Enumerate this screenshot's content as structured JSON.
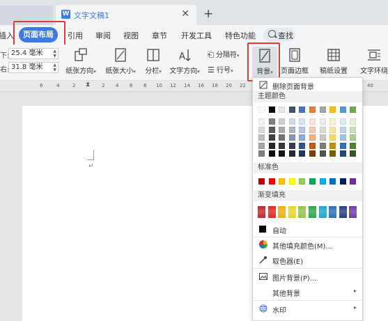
{
  "titlebar": {
    "doc_icon": "W",
    "doc_title": "文字文稿1",
    "close_symbol": "✕",
    "new_tab_symbol": "+"
  },
  "menu": {
    "items_left": "插入",
    "active": "页面布局",
    "items": [
      "引用",
      "审阅",
      "视图",
      "章节",
      "开发工具",
      "特色功能"
    ],
    "search": "查找"
  },
  "ribbon": {
    "margin_top_label": "下:",
    "margin_top_value": "25.4 毫米",
    "margin_right_label": "右:",
    "margin_right_value": "31.8 毫米",
    "buttons": [
      "纸张方向",
      "纸张大小",
      "分栏",
      "文字方向",
      "背景",
      "页面边框",
      "稿纸设置",
      "文字环绕"
    ],
    "small_buttons": [
      "分隔符",
      "行号"
    ]
  },
  "ruler": {
    "numbers": [
      "6",
      "4",
      "2",
      "2",
      "4",
      "6",
      "8",
      "10",
      "12",
      "14",
      "16",
      "18",
      "20",
      "22",
      "24",
      "26",
      "28",
      "30",
      "32",
      "34",
      "36",
      "38",
      "40"
    ]
  },
  "dropdown": {
    "remove_bg": "删除页面背景",
    "theme_colors_title": "主题颜色",
    "standard_colors_title": "标准色",
    "gradient_title": "渐变填充",
    "auto": "自动",
    "more_fill": "其他填充颜色(M)...",
    "eyedropper": "取色器(E)",
    "picture_bg": "图片背景(P)...",
    "other_bg": "其他背景",
    "watermark": "水印",
    "theme_top_row": [
      "#ffffff",
      "#000000",
      "#e7e6e6",
      "#44546a",
      "#4472c4",
      "#ed7d31",
      "#a5a5a5",
      "#ffc000",
      "#5b9bd5",
      "#70ad47"
    ],
    "theme_shades": [
      [
        "#f2f2f2",
        "#7f7f7f",
        "#d0cece",
        "#d6dce4",
        "#d9e2f3",
        "#fbe5d6",
        "#ededed",
        "#fff2cc",
        "#deebf7",
        "#e2f0d9"
      ],
      [
        "#d9d9d9",
        "#595959",
        "#aeabab",
        "#adb9ca",
        "#b4c7e7",
        "#f8cbad",
        "#dbdbdb",
        "#ffe699",
        "#bdd7ee",
        "#c5e0b4"
      ],
      [
        "#bfbfbf",
        "#404040",
        "#757171",
        "#8497b0",
        "#8faadc",
        "#f4b183",
        "#c9c9c9",
        "#ffd966",
        "#9dc3e6",
        "#a9d18e"
      ],
      [
        "#a6a6a6",
        "#262626",
        "#3a3838",
        "#333f50",
        "#2f5597",
        "#c55a11",
        "#7b7b7b",
        "#bf9000",
        "#2e75b6",
        "#548235"
      ],
      [
        "#7f7f7f",
        "#0d0d0d",
        "#171616",
        "#222a35",
        "#1f3864",
        "#843c0b",
        "#525252",
        "#7f6000",
        "#1f4e79",
        "#385723"
      ]
    ],
    "standard": [
      "#c00000",
      "#ff0000",
      "#ffc000",
      "#ffff00",
      "#92d050",
      "#00b050",
      "#00b0f0",
      "#0070c0",
      "#002060",
      "#7030a0"
    ],
    "gradients": [
      "#c0272d",
      "#e1262b",
      "#e8b117",
      "#e6d62a",
      "#8fc548",
      "#2aa64a",
      "#1fa6c9",
      "#2b6fb8",
      "#253d88",
      "#6b3c99"
    ]
  },
  "colors": {
    "accent": "#3b79e4",
    "highlight": "#e53b2e"
  }
}
